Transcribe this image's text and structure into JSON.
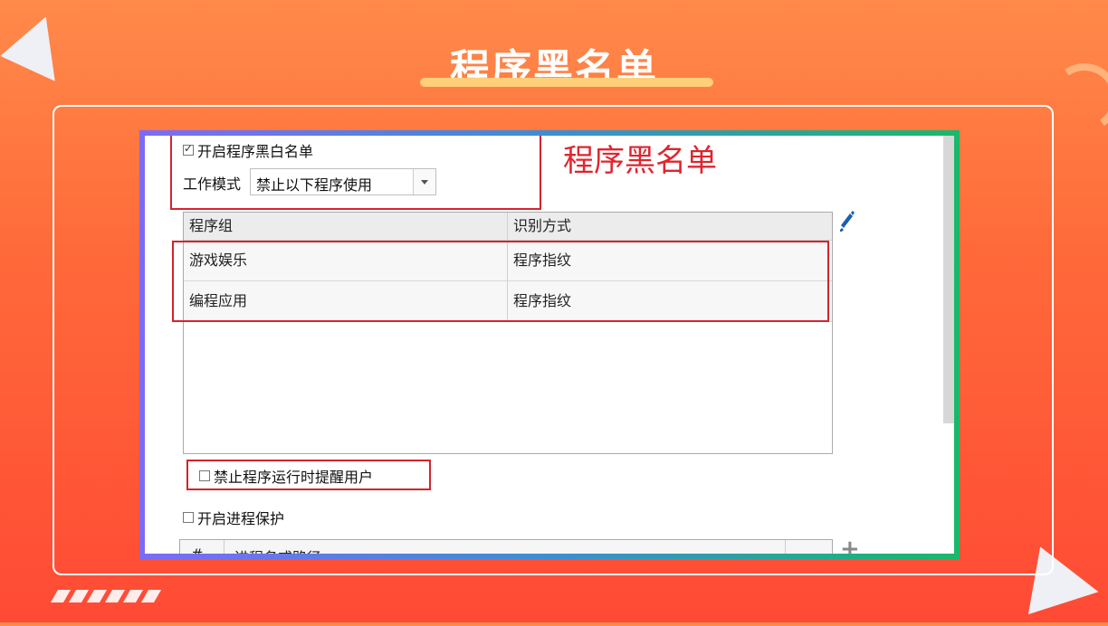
{
  "slide": {
    "title": "程序黑名单"
  },
  "settings": {
    "enable_checkbox_label": "开启程序黑白名单",
    "enable_checked": true,
    "work_mode_label": "工作模式",
    "work_mode_value": "禁止以下程序使用",
    "annotation": "程序黑名单"
  },
  "table": {
    "headers": [
      "程序组",
      "识别方式"
    ],
    "rows": [
      [
        "游戏娱乐",
        "程序指纹"
      ],
      [
        "编程应用",
        "程序指纹"
      ]
    ]
  },
  "options": {
    "notify_label": "禁止程序运行时提醒用户",
    "notify_checked": false,
    "protect_label": "开启进程保护",
    "protect_checked": false
  },
  "process_table": {
    "headers": [
      "#",
      "进程名或路径"
    ]
  },
  "colors": {
    "annotation_red": "#d4232d",
    "accent_edit": "#1a5fb4"
  }
}
